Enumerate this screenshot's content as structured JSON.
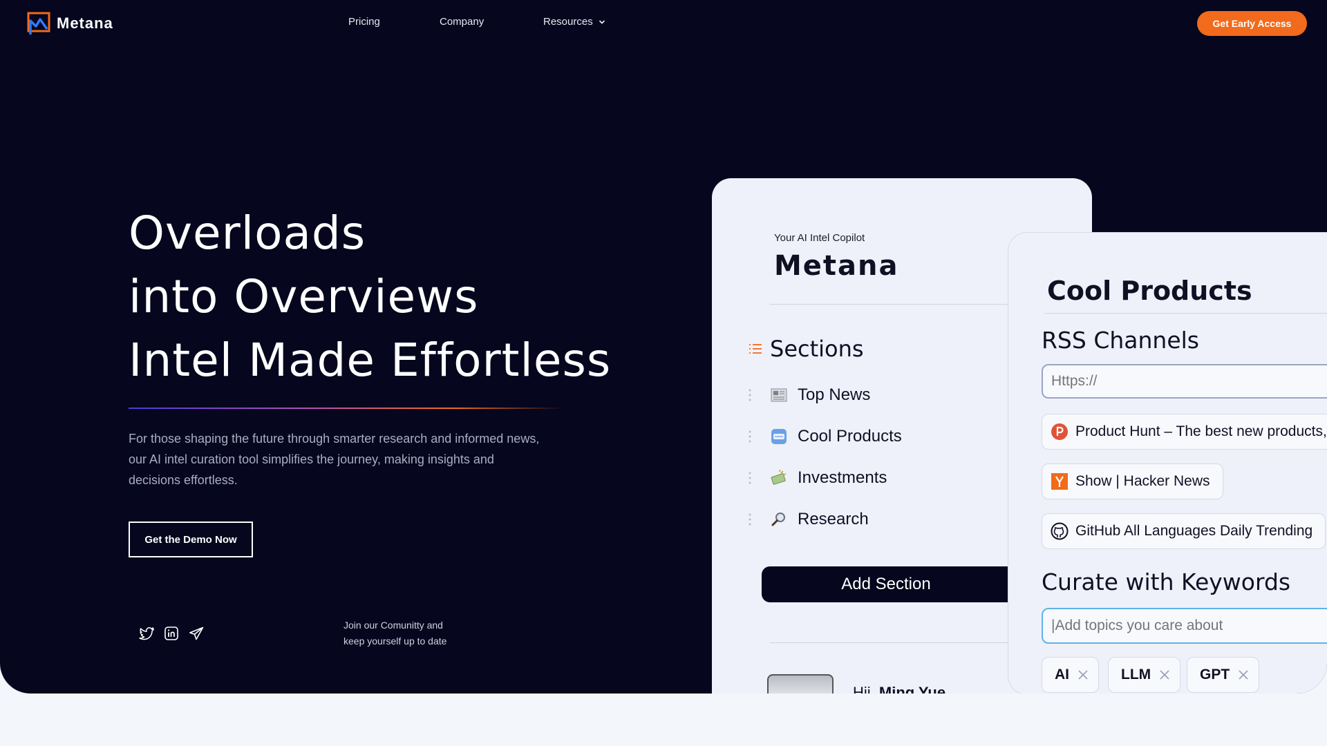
{
  "nav": {
    "brand": "Metana",
    "links": {
      "pricing": "Pricing",
      "company": "Company",
      "resources": "Resources"
    },
    "cta": "Get Early Access"
  },
  "hero": {
    "headline": [
      "Overloads",
      "into Overviews",
      "Intel Made Effortless"
    ],
    "description": "For those shaping the future through smarter research and informed news, our AI intel curation tool simplifies the journey, making insights and decisions effortless.",
    "demo_button": "Get the Demo Now",
    "community": [
      "Join our Comunitty and",
      "keep yourself up to date"
    ]
  },
  "app": {
    "copilot_label": "Your AI Intel Copilot",
    "brand": "Metana",
    "sections_title": "Sections",
    "sections": [
      {
        "label": "Top News",
        "icon": "newspaper-icon"
      },
      {
        "label": "Cool Products",
        "icon": "cool-icon"
      },
      {
        "label": "Investments",
        "icon": "money-icon"
      },
      {
        "label": "Research",
        "icon": "magnifier-icon"
      }
    ],
    "add_section": "Add Section",
    "greeting_prefix": "Hii,",
    "greeting_name": "Ming Yue"
  },
  "detail": {
    "title": "Cool Products",
    "rss_title": "RSS Channels",
    "rss_placeholder": "Https://",
    "channels": [
      "Product Hunt  – The best new products,",
      "Show | Hacker News",
      "GitHub All Languages Daily Trending"
    ],
    "keywords_title": "Curate with Keywords",
    "keywords_placeholder": "|Add topics you care about",
    "tags": [
      "AI",
      "LLM",
      "GPT"
    ]
  },
  "colors": {
    "background": "#06061e",
    "accent": "#f26a1b",
    "page": "#f3f6fa"
  }
}
